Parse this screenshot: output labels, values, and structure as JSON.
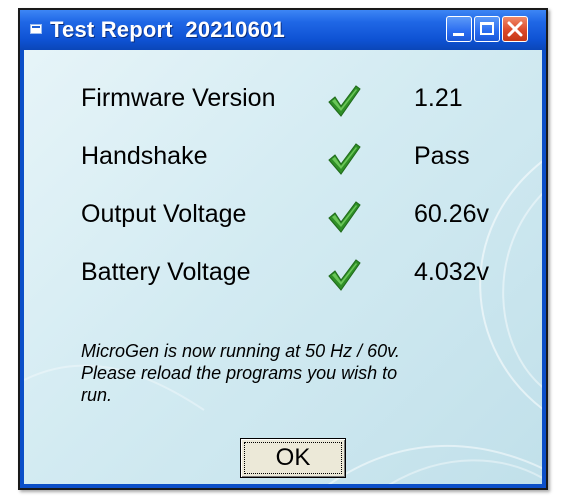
{
  "window": {
    "title": "Test Report  20210601",
    "controls": {
      "minimize": "minimize",
      "maximize": "maximize",
      "close": "close"
    }
  },
  "results": [
    {
      "label": "Firmware Version",
      "status": "pass",
      "icon": "green-check-icon",
      "value": "1.21"
    },
    {
      "label": "Handshake",
      "status": "pass",
      "icon": "green-check-icon",
      "value": "Pass"
    },
    {
      "label": "Output Voltage",
      "status": "pass",
      "icon": "green-check-icon",
      "value": "60.26v"
    },
    {
      "label": "Battery Voltage",
      "status": "pass",
      "icon": "green-check-icon",
      "value": "4.032v"
    }
  ],
  "message": {
    "line1": "MicroGen is now running at 50 Hz / 60v.",
    "line2": "Please reload the programs you wish to",
    "line3": "run."
  },
  "ok_button": {
    "label": "OK"
  },
  "colors": {
    "titlebar": "#0e52d3",
    "client_bg": "#d3ebf2",
    "check": "#3aa832",
    "close_button": "#dc4a2a"
  }
}
